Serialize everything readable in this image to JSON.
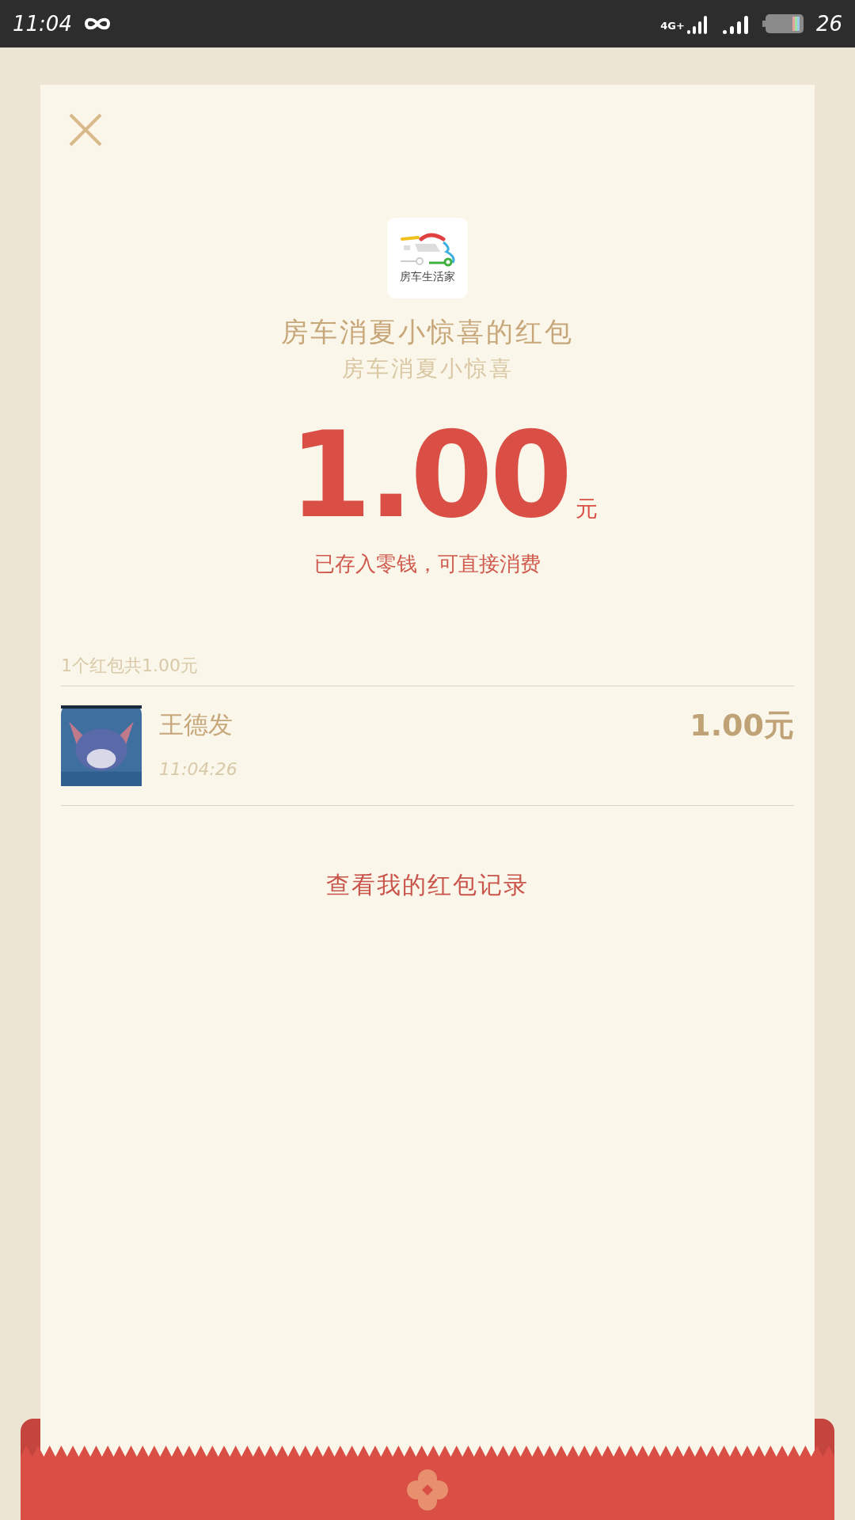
{
  "status_bar": {
    "time": "11:04",
    "network": "4G+",
    "battery": "26"
  },
  "logo": {
    "text": "房车生活家"
  },
  "title": "房车消夏小惊喜的红包",
  "subtitle": "房车消夏小惊喜",
  "amount": {
    "value": "1.00",
    "unit": "元",
    "note": "已存入零钱，可直接消费"
  },
  "summary": "1个红包共1.00元",
  "recipients": [
    {
      "name": "王德发",
      "time": "11:04:26",
      "amount": "1.00元"
    }
  ],
  "record_link": "查看我的红包记录"
}
